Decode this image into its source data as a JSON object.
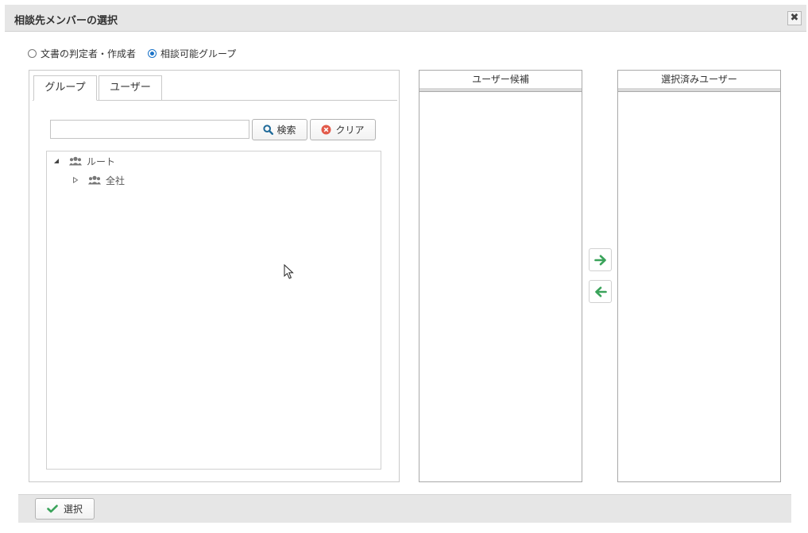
{
  "dialog": {
    "title": "相談先メンバーの選択",
    "close_glyph": "✖"
  },
  "radios": [
    {
      "label": "文書の判定者・作成者",
      "checked": false
    },
    {
      "label": "相談可能グループ",
      "checked": true
    }
  ],
  "tabs": [
    {
      "label": "グループ",
      "active": true
    },
    {
      "label": "ユーザー",
      "active": false
    }
  ],
  "search": {
    "value": "",
    "placeholder": "",
    "search_label": "検索",
    "clear_label": "クリア"
  },
  "tree": {
    "root": {
      "label": "ルート",
      "expanded": true
    },
    "children": [
      {
        "label": "全社",
        "expanded": false
      }
    ]
  },
  "candidates": {
    "header": "ユーザー候補",
    "items": []
  },
  "selected": {
    "header": "選択済みユーザー",
    "items": []
  },
  "footer": {
    "select_label": "選択"
  },
  "colors": {
    "accent_green": "#3aa35a",
    "clear_red": "#e25a4a",
    "search_blue": "#1f6a99",
    "radio_blue": "#1a73c8"
  },
  "icons": {
    "close": "close-icon",
    "search": "search-icon",
    "clear": "clear-icon",
    "group": "group-icon",
    "add": "arrow-right-icon",
    "remove": "arrow-left-icon",
    "confirm": "check-icon"
  }
}
